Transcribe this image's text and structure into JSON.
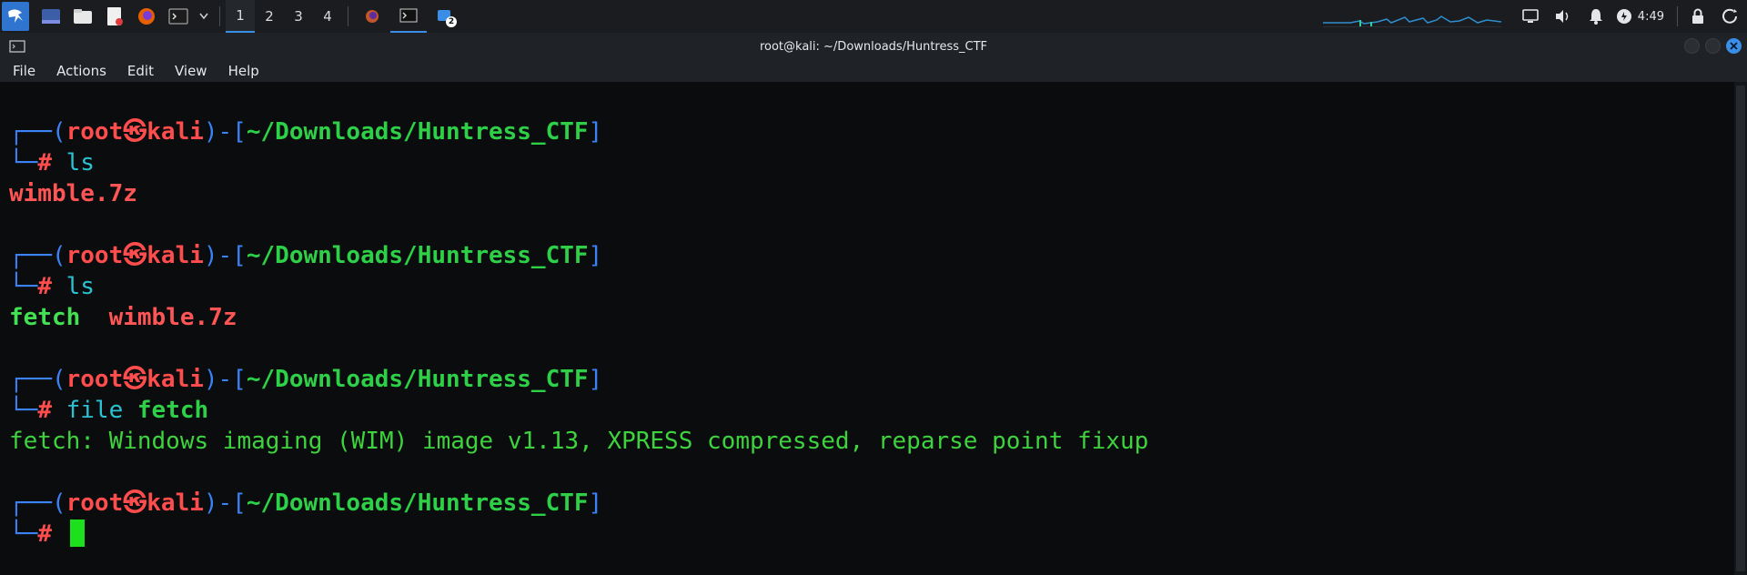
{
  "taskbar": {
    "workspaces": [
      "1",
      "2",
      "3",
      "4"
    ],
    "active_workspace": "1",
    "notification_count": "2",
    "clock": "4:49"
  },
  "window": {
    "title": "root@kali: ~/Downloads/Huntress_CTF",
    "menu": [
      "File",
      "Actions",
      "Edit",
      "View",
      "Help"
    ]
  },
  "terminal": {
    "prompt": {
      "user": "root",
      "at_symbol": "㉿",
      "host": "kali",
      "path": "~/Downloads/Huntress_CTF",
      "hash": "#"
    },
    "blocks": [
      {
        "command": "ls",
        "arg": "",
        "output": [
          {
            "text": "wimble.7z",
            "style": "red"
          }
        ]
      },
      {
        "command": "ls",
        "arg": "",
        "output": [
          {
            "text": "fetch",
            "style": "green-bold"
          },
          {
            "text": "  ",
            "style": "plain"
          },
          {
            "text": "wimble.7z",
            "style": "red"
          }
        ]
      },
      {
        "command": "file",
        "arg": "fetch",
        "output": [
          {
            "text": "fetch: Windows imaging (WIM) image v1.13, XPRESS compressed, reparse point fixup",
            "style": "plain"
          }
        ]
      },
      {
        "command": "",
        "arg": "",
        "output": []
      }
    ]
  },
  "colors": {
    "accent": "#3b8ee8",
    "prompt_frame": "#3b82f6",
    "prompt_user": "#ff4d4d",
    "prompt_path": "#2ed047",
    "command": "#2cc2d4"
  }
}
